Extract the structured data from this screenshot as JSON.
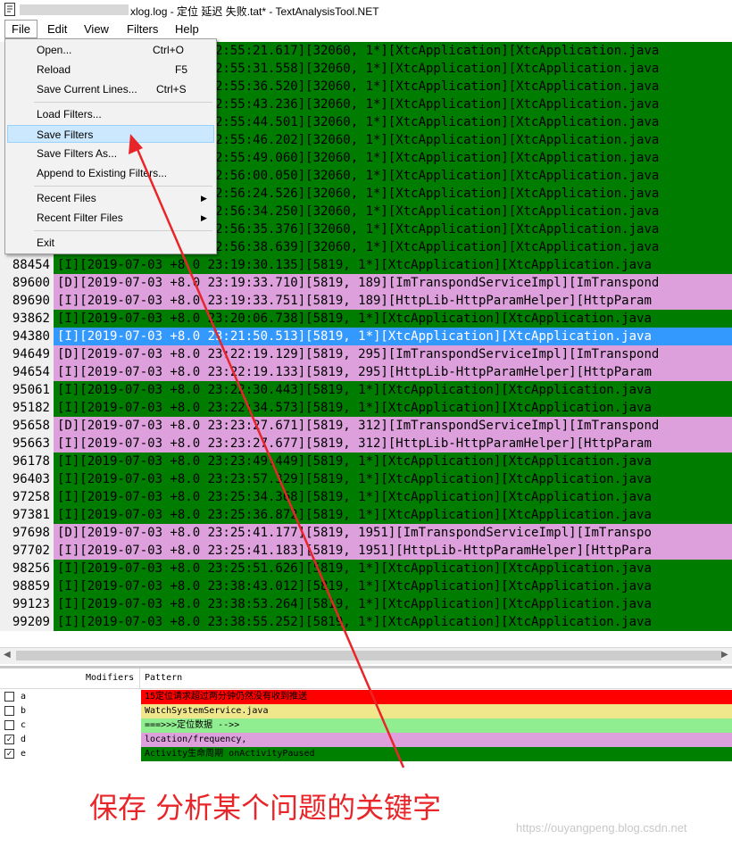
{
  "window": {
    "title": "xlog.log - 定位 延迟 失败.tat* - TextAnalysisTool.NET"
  },
  "menubar": [
    "File",
    "Edit",
    "View",
    "Filters",
    "Help"
  ],
  "file_menu": [
    {
      "label": "Open...",
      "shortcut": "Ctrl+O"
    },
    {
      "label": "Reload",
      "shortcut": "F5"
    },
    {
      "label": "Save Current Lines...",
      "shortcut": "Ctrl+S"
    },
    {
      "label": "Load Filters...",
      "shortcut": ""
    },
    {
      "label": "Save Filters",
      "shortcut": ""
    },
    {
      "label": "Save Filters As...",
      "shortcut": ""
    },
    {
      "label": "Append to Existing Filters...",
      "shortcut": ""
    },
    {
      "label": "Recent Files",
      "submenu": true
    },
    {
      "label": "Recent Filter Files",
      "submenu": true
    },
    {
      "label": "Exit",
      "shortcut": ""
    }
  ],
  "log_rows": [
    {
      "line": "",
      "kind": "green",
      "text": "[I][2019-07-03 +8.0 22:55:21.617][32060, 1*][XtcApplication][XtcApplication.java"
    },
    {
      "line": "",
      "kind": "green",
      "text": "[I][2019-07-03 +8.0 22:55:31.558][32060, 1*][XtcApplication][XtcApplication.java"
    },
    {
      "line": "",
      "kind": "green",
      "text": "[I][2019-07-03 +8.0 22:55:36.520][32060, 1*][XtcApplication][XtcApplication.java"
    },
    {
      "line": "",
      "kind": "green",
      "text": "[I][2019-07-03 +8.0 22:55:43.236][32060, 1*][XtcApplication][XtcApplication.java"
    },
    {
      "line": "",
      "kind": "green",
      "text": "[I][2019-07-03 +8.0 22:55:44.501][32060, 1*][XtcApplication][XtcApplication.java"
    },
    {
      "line": "",
      "kind": "green",
      "text": "[I][2019-07-03 +8.0 22:55:46.202][32060, 1*][XtcApplication][XtcApplication.java"
    },
    {
      "line": "",
      "kind": "green",
      "text": "[I][2019-07-03 +8.0 22:55:49.060][32060, 1*][XtcApplication][XtcApplication.java"
    },
    {
      "line": "",
      "kind": "green",
      "text": "[I][2019-07-03 +8.0 22:56:00.050][32060, 1*][XtcApplication][XtcApplication.java"
    },
    {
      "line": "",
      "kind": "green",
      "text": "[I][2019-07-03 +8.0 22:56:24.526][32060, 1*][XtcApplication][XtcApplication.java"
    },
    {
      "line": "",
      "kind": "green",
      "text": "[I][2019-07-03 +8.0 22:56:34.250][32060, 1*][XtcApplication][XtcApplication.java"
    },
    {
      "line": "",
      "kind": "green",
      "text": "[I][2019-07-03 +8.0 22:56:35.376][32060, 1*][XtcApplication][XtcApplication.java"
    },
    {
      "line": "",
      "kind": "green",
      "text": "[I][2019-07-03 +8.0 22:56:38.639][32060, 1*][XtcApplication][XtcApplication.java"
    },
    {
      "line": "88454",
      "kind": "green",
      "text": "[I][2019-07-03 +8.0 23:19:30.135][5819, 1*][XtcApplication][XtcApplication.java"
    },
    {
      "line": "89600",
      "kind": "pink",
      "text": "[D][2019-07-03 +8.0 23:19:33.710][5819, 189][ImTranspondServiceImpl][ImTranspond"
    },
    {
      "line": "89690",
      "kind": "pink",
      "text": "[I][2019-07-03 +8.0 23:19:33.751][5819, 189][HttpLib-HttpParamHelper][HttpParam"
    },
    {
      "line": "93862",
      "kind": "green",
      "text": "[I][2019-07-03 +8.0 23:20:06.738][5819, 1*][XtcApplication][XtcApplication.java"
    },
    {
      "line": "94380",
      "kind": "sel",
      "text": "[I][2019-07-03 +8.0 23:21:50.513][5819, 1*][XtcApplication][XtcApplication.java"
    },
    {
      "line": "94649",
      "kind": "pink",
      "text": "[D][2019-07-03 +8.0 23:22:19.129][5819, 295][ImTranspondServiceImpl][ImTranspond"
    },
    {
      "line": "94654",
      "kind": "pink",
      "text": "[I][2019-07-03 +8.0 23:22:19.133][5819, 295][HttpLib-HttpParamHelper][HttpParam"
    },
    {
      "line": "95061",
      "kind": "green",
      "text": "[I][2019-07-03 +8.0 23:22:30.443][5819, 1*][XtcApplication][XtcApplication.java"
    },
    {
      "line": "95182",
      "kind": "green",
      "text": "[I][2019-07-03 +8.0 23:22:34.573][5819, 1*][XtcApplication][XtcApplication.java"
    },
    {
      "line": "95658",
      "kind": "pink",
      "text": "[D][2019-07-03 +8.0 23:23:27.671][5819, 312][ImTranspondServiceImpl][ImTranspond"
    },
    {
      "line": "95663",
      "kind": "pink",
      "text": "[I][2019-07-03 +8.0 23:23:27.677][5819, 312][HttpLib-HttpParamHelper][HttpParam"
    },
    {
      "line": "96178",
      "kind": "green",
      "text": "[I][2019-07-03 +8.0 23:23:49.449][5819, 1*][XtcApplication][XtcApplication.java"
    },
    {
      "line": "96403",
      "kind": "green",
      "text": "[I][2019-07-03 +8.0 23:23:57.329][5819, 1*][XtcApplication][XtcApplication.java"
    },
    {
      "line": "97258",
      "kind": "green",
      "text": "[I][2019-07-03 +8.0 23:25:34.368][5819, 1*][XtcApplication][XtcApplication.java"
    },
    {
      "line": "97381",
      "kind": "green",
      "text": "[I][2019-07-03 +8.0 23:25:36.872][5819, 1*][XtcApplication][XtcApplication.java"
    },
    {
      "line": "97698",
      "kind": "pink",
      "text": "[D][2019-07-03 +8.0 23:25:41.177][5819, 1951][ImTranspondServiceImpl][ImTranspo"
    },
    {
      "line": "97702",
      "kind": "pink",
      "text": "[I][2019-07-03 +8.0 23:25:41.183][5819, 1951][HttpLib-HttpParamHelper][HttpPara"
    },
    {
      "line": "98256",
      "kind": "green",
      "text": "[I][2019-07-03 +8.0 23:25:51.626][5819, 1*][XtcApplication][XtcApplication.java"
    },
    {
      "line": "98859",
      "kind": "green",
      "text": "[I][2019-07-03 +8.0 23:38:43.012][5819, 1*][XtcApplication][XtcApplication.java"
    },
    {
      "line": "99123",
      "kind": "green",
      "text": "[I][2019-07-03 +8.0 23:38:53.264][5819, 1*][XtcApplication][XtcApplication.java"
    },
    {
      "line": "99209",
      "kind": "green",
      "text": "[I][2019-07-03 +8.0 23:38:55.252][5819, 1*][XtcApplication][XtcApplication.java"
    }
  ],
  "filters": {
    "header_modifiers": "Modifiers",
    "header_pattern": "Pattern",
    "rows": [
      {
        "letter": "a",
        "checked": false,
        "pattern": "15定位请求超过两分钟仍然没有收到推送",
        "bg": "#ff0000"
      },
      {
        "letter": "b",
        "checked": false,
        "pattern": "WatchSystemService.java",
        "bg": "#f0e68c"
      },
      {
        "letter": "c",
        "checked": false,
        "pattern": "===>>>定位数据 -->>",
        "bg": "#90ee90"
      },
      {
        "letter": "d",
        "checked": true,
        "pattern": "location/frequency,",
        "bg": "#dda0dd"
      },
      {
        "letter": "e",
        "checked": true,
        "pattern": "Activity生命周期 onActivityPaused",
        "bg": "#008000"
      }
    ]
  },
  "annotation": {
    "caption": "保存 分析某个问题的关键字",
    "color": "#e8262a"
  },
  "watermark": "https://ouyangpeng.blog.csdn.net"
}
